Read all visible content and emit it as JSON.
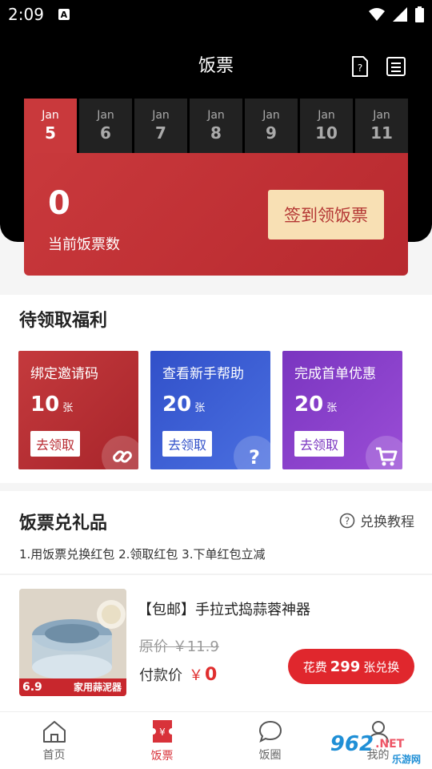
{
  "status": {
    "time": "2:09",
    "indicator": "A"
  },
  "header": {
    "title": "饭票",
    "help_icon": "question-doc-icon",
    "list_icon": "list-icon"
  },
  "dates": [
    {
      "month": "Jan",
      "day": "5",
      "active": true
    },
    {
      "month": "Jan",
      "day": "6"
    },
    {
      "month": "Jan",
      "day": "7"
    },
    {
      "month": "Jan",
      "day": "8"
    },
    {
      "month": "Jan",
      "day": "9"
    },
    {
      "month": "Jan",
      "day": "10"
    },
    {
      "month": "Jan",
      "day": "11"
    }
  ],
  "ticket": {
    "count": "0",
    "label": "当前饭票数",
    "checkin_label": "签到领饭票"
  },
  "welfare": {
    "title": "待领取福利",
    "cards": [
      {
        "title": "绑定邀请码",
        "num": "10",
        "unit": "张",
        "button": "去领取",
        "color": "#b8292f",
        "icon": "link-icon"
      },
      {
        "title": "查看新手帮助",
        "num": "20",
        "unit": "张",
        "button": "去领取",
        "color": "#3d5bd6",
        "icon": "question-icon"
      },
      {
        "title": "完成首单优惠",
        "num": "20",
        "unit": "张",
        "button": "去领取",
        "color": "#8c3fc8",
        "icon": "cart-icon"
      }
    ]
  },
  "gifts": {
    "title": "饭票兑礼品",
    "tutorial_label": "兑换教程",
    "rules": "1.用饭票兑换红包 2.领取红包 3.下单红包立减",
    "product": {
      "title": "【包邮】手拉式捣蒜蓉神器",
      "original_price": "原价 ￥11.9",
      "pay_label": "付款价",
      "pay_currency": "￥",
      "pay_value": "0",
      "redeem_prefix": "花费",
      "redeem_num": "299",
      "redeem_suffix": "张兑换",
      "image_badge_price": "6.9",
      "image_badge_text": "家用蒜泥器"
    }
  },
  "nav": [
    {
      "label": "首页",
      "icon": "home-icon"
    },
    {
      "label": "饭票",
      "icon": "ticket-icon",
      "active": true
    },
    {
      "label": "饭圈",
      "icon": "chat-bubble-icon"
    },
    {
      "label": "我的",
      "icon": "profile-icon"
    }
  ],
  "watermark": {
    "text": "962",
    "suffix": ".NET",
    "subtitle": "乐游网"
  },
  "colors": {
    "brand_red": "#c9393c",
    "dark_bg": "#000000",
    "checkin_bg": "#f8e0b4",
    "redeem_red": "#e0272d"
  }
}
